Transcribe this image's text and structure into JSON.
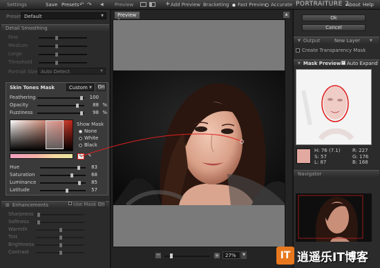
{
  "topbar": {
    "settings": "Settings",
    "save": "Save",
    "presets": "Presets",
    "preview": "Preview",
    "add_preview": "Add Preview",
    "bracketing": "Bracketing",
    "fast_preview": "Fast Preview",
    "accurate": "Accurate",
    "app_title": "PORTRAITURE 2",
    "about": "About",
    "help": "Help"
  },
  "left": {
    "preset_label": "Preset",
    "preset_value": "Default",
    "detail_smoothing": {
      "title": "Detail Smoothing",
      "sliders": [
        {
          "label": "Fine",
          "value": ""
        },
        {
          "label": "Medium",
          "value": ""
        },
        {
          "label": "Large",
          "value": ""
        },
        {
          "label": "Threshold",
          "value": ""
        }
      ],
      "portrait_size_label": "Portrait Size",
      "portrait_size_value": "Auto Detect"
    },
    "skin_mask": {
      "title": "Skin Tones Mask",
      "mode": "Custom",
      "toggle": "On",
      "sliders": [
        {
          "label": "Feathering",
          "value": "100",
          "unit": ""
        },
        {
          "label": "Opacity",
          "value": "88",
          "unit": "%"
        },
        {
          "label": "Fuzziness",
          "value": "98",
          "unit": "%"
        }
      ],
      "show_mask_label": "Show Mask",
      "show_mask_options": [
        "None",
        "White",
        "Black"
      ],
      "show_mask_selected": 0,
      "hsl_sliders": [
        {
          "label": "Hue",
          "value": "83"
        },
        {
          "label": "Saturation",
          "value": "68"
        },
        {
          "label": "Luminance",
          "value": "85"
        },
        {
          "label": "Latitude",
          "value": "57"
        }
      ]
    },
    "enhancements": {
      "title": "Enhancements",
      "use_mask": "Use Mask",
      "toggle": "On",
      "sliders": [
        "Sharpness",
        "Softness",
        "Warmth",
        "Tint",
        "Brightness",
        "Contrast"
      ]
    }
  },
  "preview": {
    "tab": "Preview 1",
    "zoom": "27%"
  },
  "right": {
    "ok": "Ok",
    "cancel": "Cancel",
    "output_title": "Output",
    "output_value": "New Layer",
    "transparency": "Create Transparency Mask",
    "mask_preview_title": "Mask Preview",
    "auto_expand": "Auto Expand",
    "swatch_color": "#e2a9a0",
    "readout": {
      "h": "H: 76 (7.1)",
      "s": "S: 57",
      "l": "L: 87",
      "r": "R: 227",
      "g": "G: 176",
      "b": "B: 168"
    },
    "navigator_title": "Navigator"
  },
  "watermark": "逍遥乐IT博客",
  "colors": {
    "accent_red": "#e02020",
    "panel_bg": "#2b2b2b",
    "mask_swatch": "#e2a9a0"
  }
}
